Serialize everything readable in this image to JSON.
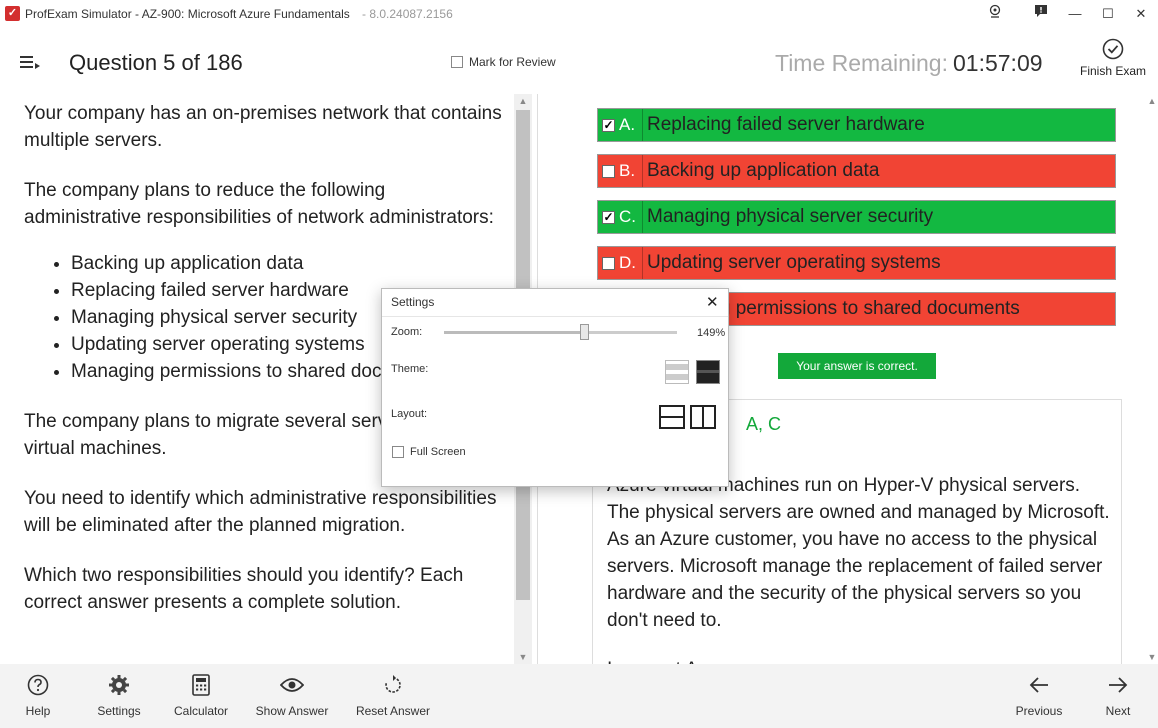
{
  "window": {
    "title": "ProfExam Simulator - AZ-900: Microsoft Azure Fundamentals",
    "version": "- 8.0.24087.2156",
    "controls": [
      "minimize",
      "maximize",
      "close"
    ]
  },
  "header": {
    "question_title": "Question 5 of 186",
    "mark_for_review": "Mark for Review",
    "mark_for_review_checked": false,
    "time_label": "Time Remaining:",
    "time_value": "01:57:09",
    "finish_label": "Finish Exam"
  },
  "question": {
    "p1": "Your company has an on-premises network that contains multiple servers.",
    "p2": "The company plans to reduce the following administrative responsibilities of network administrators:",
    "bullets": [
      "Backing up application data",
      "Replacing failed server hardware",
      "Managing physical server security",
      "Updating server operating systems",
      "Managing permissions to shared documents"
    ],
    "p3": "The company plans to migrate several servers to Azure virtual machines.",
    "p4": "You need to identify which administrative responsibilities will be eliminated after the planned migration.",
    "p5": "Which two responsibilities should you identify? Each correct answer presents a complete solution."
  },
  "answers": [
    {
      "letter": "A.",
      "text": "Replacing failed server hardware",
      "checked": true,
      "status": "correct"
    },
    {
      "letter": "B.",
      "text": "Backing up application data",
      "checked": false,
      "status": "wrong"
    },
    {
      "letter": "C.",
      "text": "Managing physical server security",
      "checked": true,
      "status": "correct"
    },
    {
      "letter": "D.",
      "text": "Updating server operating systems",
      "checked": false,
      "status": "wrong"
    },
    {
      "letter": "E.",
      "text": "Managing permissions to shared documents",
      "checked": false,
      "status": "wrong"
    }
  ],
  "result": {
    "badge": "Your answer is correct.",
    "correct_answer": "A, C",
    "explanation_p1": "Azure virtual machines run on Hyper-V physical servers. The physical servers are owned and managed by Microsoft. As an Azure customer, you have no access to the physical servers. Microsoft manage the replacement of failed server hardware and the security of the physical servers so you don't need to.",
    "explanation_p2": "Incorrect Answers:"
  },
  "settings_dialog": {
    "title": "Settings",
    "zoom_label": "Zoom:",
    "zoom_value": "149%",
    "zoom_fraction": 0.6,
    "theme_label": "Theme:",
    "layout_label": "Layout:",
    "fullscreen_label": "Full Screen",
    "fullscreen_checked": false
  },
  "toolbar": {
    "help": "Help",
    "settings": "Settings",
    "calculator": "Calculator",
    "show_answer": "Show Answer",
    "reset_answer": "Reset Answer",
    "previous": "Previous",
    "next": "Next"
  },
  "colors": {
    "correct": "#13b841",
    "wrong": "#f14434",
    "badge": "#13a83a",
    "accent_red": "#d32f2f"
  }
}
